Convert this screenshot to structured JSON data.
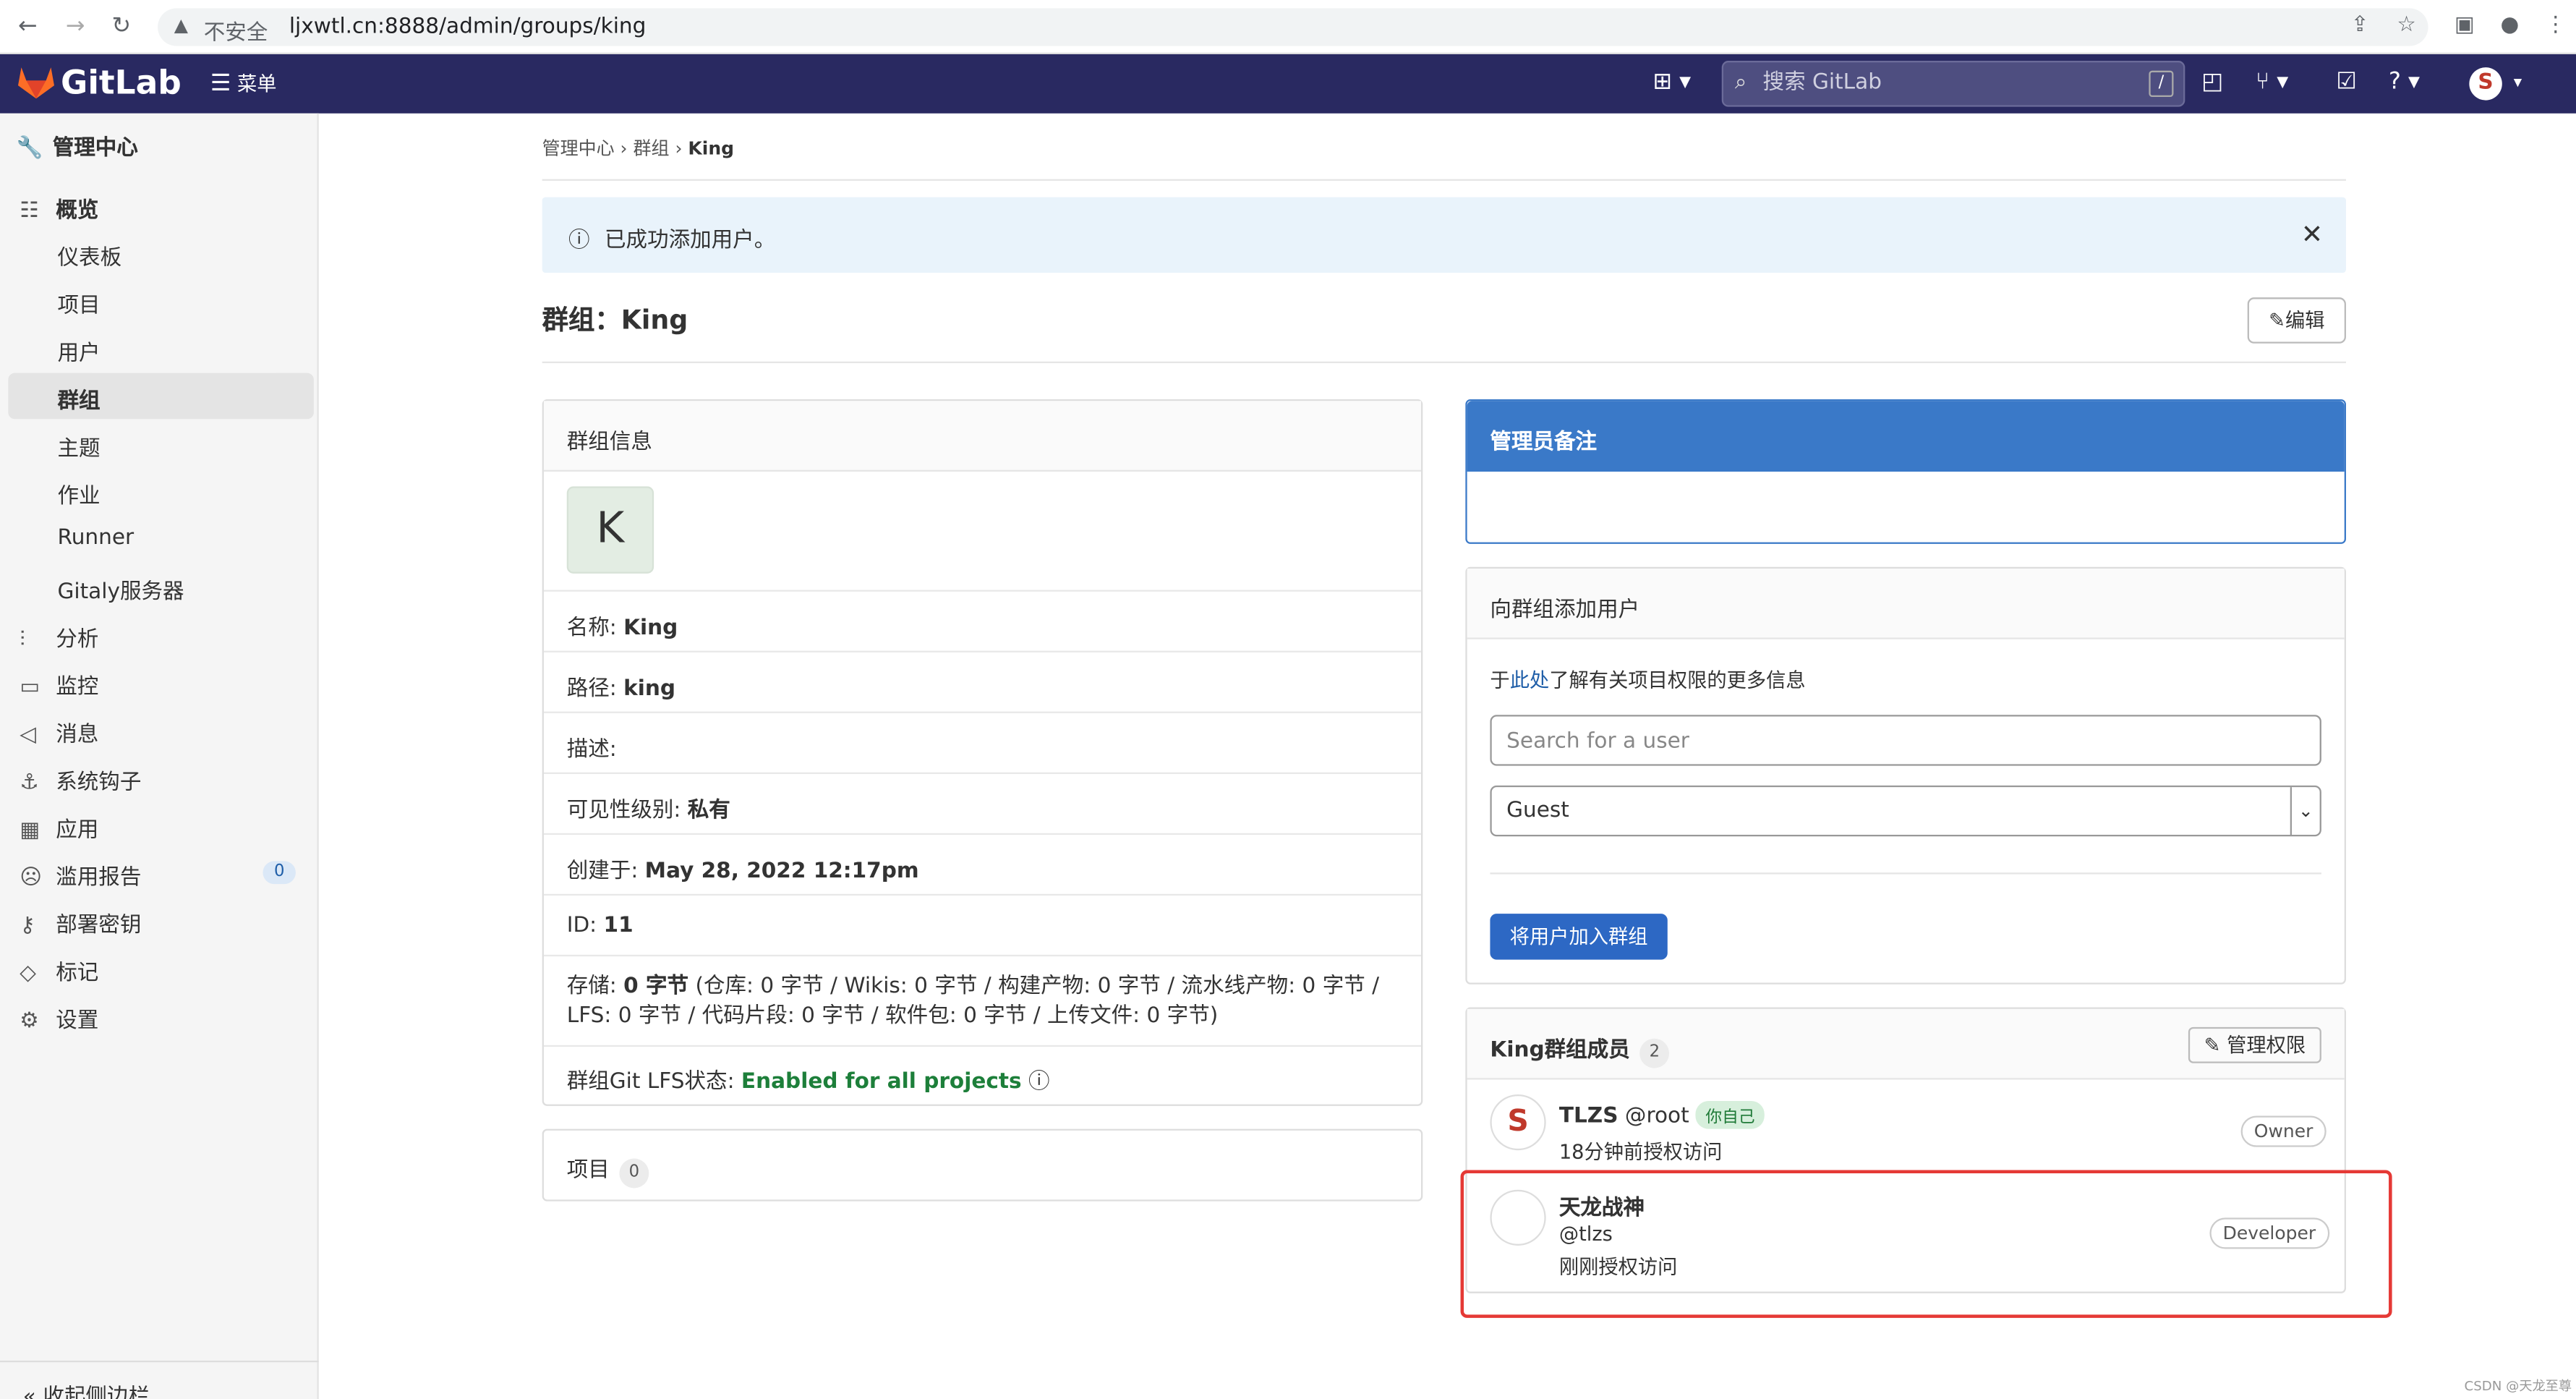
{
  "browser": {
    "security": "不安全",
    "url": "ljxwtl.cn:8888/admin/groups/king"
  },
  "topbar": {
    "brand": "GitLab",
    "menu": "菜单",
    "search_placeholder": "搜索 GitLab",
    "slash": "/"
  },
  "sidebar": {
    "header": "管理中心",
    "overview": "概览",
    "sub": [
      "仪表板",
      "项目",
      "用户",
      "群组",
      "主题",
      "作业",
      "Runner",
      "Gitaly服务器"
    ],
    "items": [
      "分析",
      "监控",
      "消息",
      "系统钩子",
      "应用",
      "滥用报告",
      "部署密钥",
      "标记",
      "设置"
    ],
    "abuse_count": "0",
    "collapse": "收起侧边栏"
  },
  "breadcrumb": [
    "管理中心",
    "群组",
    "King"
  ],
  "alert": "已成功添加用户。",
  "page_title": "群组：King",
  "edit_button": "编辑",
  "group_info": {
    "header": "群组信息",
    "avatar_letter": "K",
    "name_label": "名称: ",
    "name_value": "King",
    "path_label": "路径: ",
    "path_value": "king",
    "desc_label": "描述:",
    "vis_label": "可见性级别: ",
    "vis_value": "私有",
    "created_label": "创建于: ",
    "created_value": "May 28, 2022 12:17pm",
    "id_label": "ID: ",
    "id_value": "11",
    "storage_label": "存储: ",
    "storage_value": "0 字节",
    "storage_detail": "(仓库: 0 字节 / Wikis: 0 字节 / 构建产物: 0 字节 / 流水线产物:  0 字节 / LFS: 0 字节 / 代码片段: 0 字节 / 软件包: 0 字节 / 上传文件: 0 字节)",
    "lfs_label": "群组Git LFS状态: ",
    "lfs_value": "Enabled for all projects"
  },
  "projects": {
    "label": "项目",
    "count": "0"
  },
  "admin_notes": {
    "header": "管理员备注"
  },
  "add_user": {
    "header": "向群组添加用户",
    "hint_prefix": "于",
    "hint_link": "此处",
    "hint_suffix": "了解有关项目权限的更多信息",
    "search_placeholder": "Search for a user",
    "role": "Guest",
    "submit": "将用户加入群组"
  },
  "members": {
    "header": "King群组成员",
    "count": "2",
    "manage": "管理权限",
    "list": [
      {
        "name": "TLZS",
        "username": "@root",
        "tag": "你自己",
        "time": "18分钟前授权访问",
        "role": "Owner"
      },
      {
        "name": "天龙战神",
        "username": "@tlzs",
        "time": "刚刚授权访问",
        "role": "Developer"
      }
    ]
  },
  "watermark": "CSDN @天龙至尊"
}
